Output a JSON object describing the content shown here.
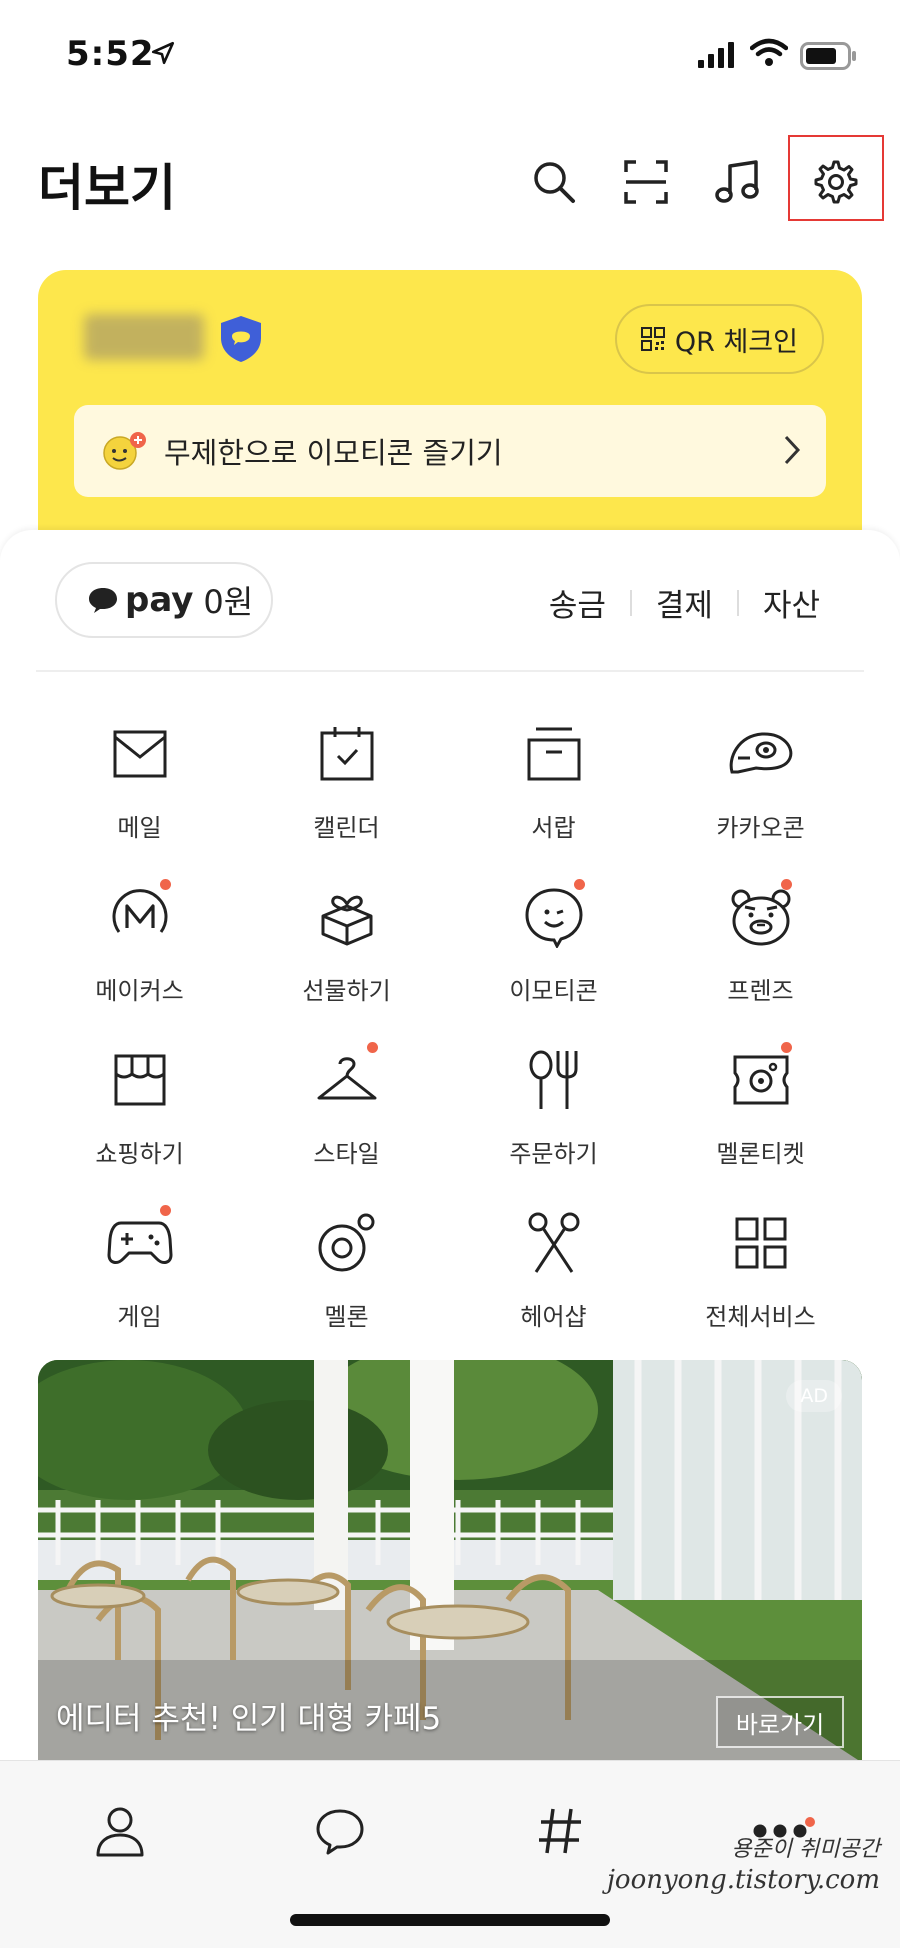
{
  "status_bar": {
    "time": "5:52"
  },
  "header": {
    "title": "더보기"
  },
  "profile": {
    "qr_label": "QR 체크인",
    "emoticon_banner": "무제한으로 이모티콘 즐기기"
  },
  "pay": {
    "logo": "pay",
    "amount": "0원",
    "links": [
      "송금",
      "결제",
      "자산"
    ]
  },
  "services": [
    {
      "label": "메일",
      "icon": "mail-icon",
      "badge": false
    },
    {
      "label": "캘린더",
      "icon": "calendar-icon",
      "badge": false
    },
    {
      "label": "서랍",
      "icon": "drawer-icon",
      "badge": false
    },
    {
      "label": "카카오콘",
      "icon": "kakaocon-icon",
      "badge": false
    },
    {
      "label": "메이커스",
      "icon": "makers-icon",
      "badge": true
    },
    {
      "label": "선물하기",
      "icon": "gift-icon",
      "badge": false
    },
    {
      "label": "이모티콘",
      "icon": "emoticon-icon",
      "badge": true
    },
    {
      "label": "프렌즈",
      "icon": "friends-icon",
      "badge": true
    },
    {
      "label": "쇼핑하기",
      "icon": "shop-icon",
      "badge": false
    },
    {
      "label": "스타일",
      "icon": "hanger-icon",
      "badge": true
    },
    {
      "label": "주문하기",
      "icon": "utensils-icon",
      "badge": false
    },
    {
      "label": "멜론티켓",
      "icon": "ticket-icon",
      "badge": true
    },
    {
      "label": "게임",
      "icon": "gamepad-icon",
      "badge": true
    },
    {
      "label": "멜론",
      "icon": "melon-icon",
      "badge": false
    },
    {
      "label": "헤어샵",
      "icon": "scissors-icon",
      "badge": false
    },
    {
      "label": "전체서비스",
      "icon": "grid-icon",
      "badge": false
    }
  ],
  "ad": {
    "badge": "AD",
    "title": "에디터 추천! 인기 대형 카페5",
    "button": "바로가기"
  },
  "watermark": {
    "line1": "용준이 취미공간",
    "line2": "joonyong.tistory.com"
  },
  "colors": {
    "card_yellow": "#fde74c",
    "badge_dot": "#f0654a",
    "highlight_box": "#e53935"
  }
}
